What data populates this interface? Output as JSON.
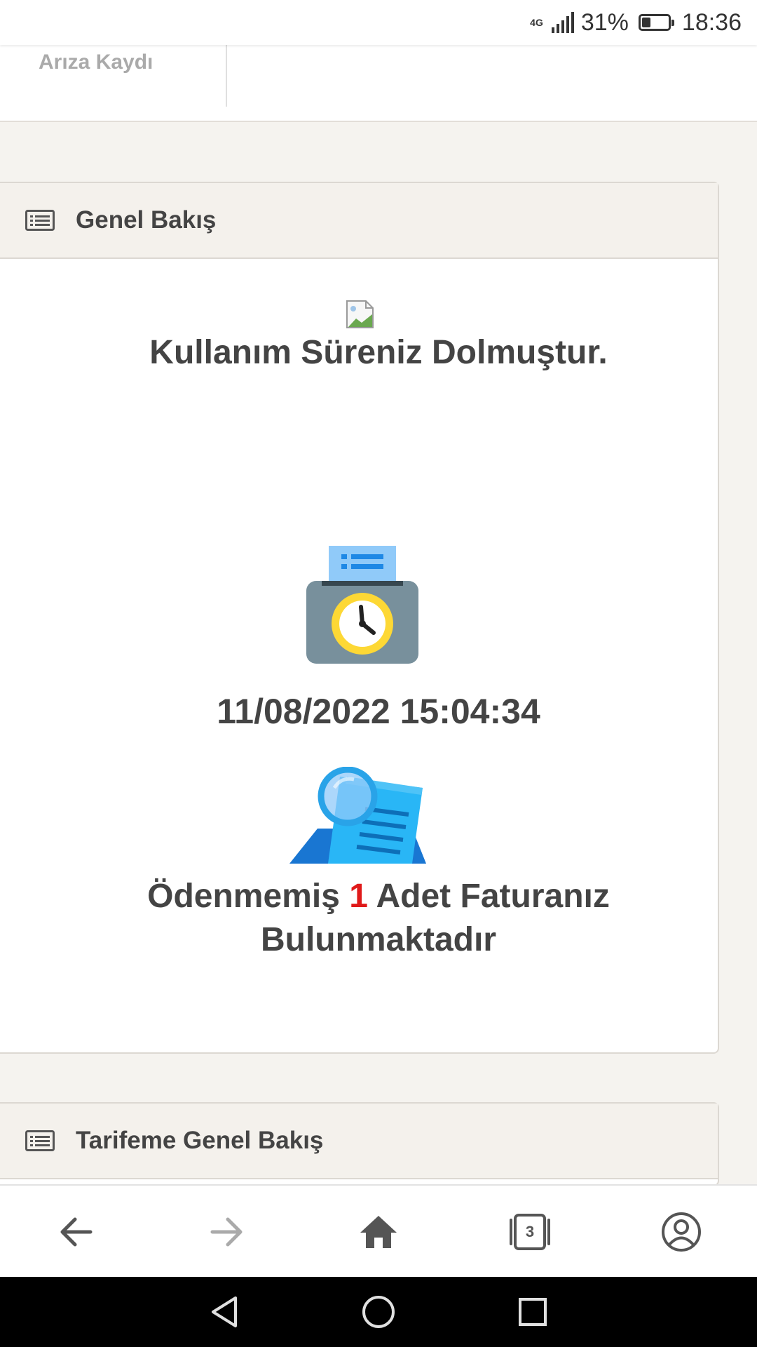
{
  "status_bar": {
    "network": "4G",
    "battery": "31%",
    "time": "18:36"
  },
  "top_nav": {
    "item_label": "Arıza Kaydı"
  },
  "overview_panel": {
    "title": "Genel Bakış",
    "expired_message": "Kullanım Süreniz Dolmuştur.",
    "datetime": "11/08/2022 15:04:34",
    "unpaid_prefix": "Ödenmemiş",
    "unpaid_count": "1",
    "unpaid_suffix": "Adet Faturanız Bulunmaktadır"
  },
  "tariff_panel": {
    "title": "Tarifeme Genel Bakış"
  },
  "browser_bar": {
    "tab_count": "3",
    "icons": [
      "back-arrow-icon",
      "forward-arrow-icon",
      "home-icon",
      "tabs-icon",
      "account-icon"
    ]
  },
  "colors": {
    "accent_red": "#e01a1a",
    "panel_header_bg": "#f4f1ec",
    "page_bg": "#f5f3ef"
  }
}
